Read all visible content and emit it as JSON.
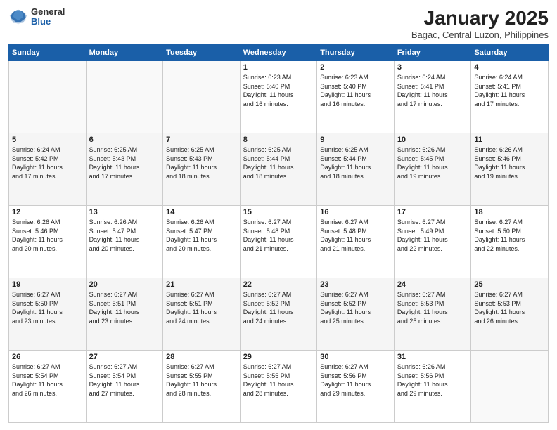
{
  "logo": {
    "general": "General",
    "blue": "Blue"
  },
  "header": {
    "title": "January 2025",
    "subtitle": "Bagac, Central Luzon, Philippines"
  },
  "weekdays": [
    "Sunday",
    "Monday",
    "Tuesday",
    "Wednesday",
    "Thursday",
    "Friday",
    "Saturday"
  ],
  "weeks": [
    [
      {
        "day": "",
        "info": ""
      },
      {
        "day": "",
        "info": ""
      },
      {
        "day": "",
        "info": ""
      },
      {
        "day": "1",
        "info": "Sunrise: 6:23 AM\nSunset: 5:40 PM\nDaylight: 11 hours\nand 16 minutes."
      },
      {
        "day": "2",
        "info": "Sunrise: 6:23 AM\nSunset: 5:40 PM\nDaylight: 11 hours\nand 16 minutes."
      },
      {
        "day": "3",
        "info": "Sunrise: 6:24 AM\nSunset: 5:41 PM\nDaylight: 11 hours\nand 17 minutes."
      },
      {
        "day": "4",
        "info": "Sunrise: 6:24 AM\nSunset: 5:41 PM\nDaylight: 11 hours\nand 17 minutes."
      }
    ],
    [
      {
        "day": "5",
        "info": "Sunrise: 6:24 AM\nSunset: 5:42 PM\nDaylight: 11 hours\nand 17 minutes."
      },
      {
        "day": "6",
        "info": "Sunrise: 6:25 AM\nSunset: 5:43 PM\nDaylight: 11 hours\nand 17 minutes."
      },
      {
        "day": "7",
        "info": "Sunrise: 6:25 AM\nSunset: 5:43 PM\nDaylight: 11 hours\nand 18 minutes."
      },
      {
        "day": "8",
        "info": "Sunrise: 6:25 AM\nSunset: 5:44 PM\nDaylight: 11 hours\nand 18 minutes."
      },
      {
        "day": "9",
        "info": "Sunrise: 6:25 AM\nSunset: 5:44 PM\nDaylight: 11 hours\nand 18 minutes."
      },
      {
        "day": "10",
        "info": "Sunrise: 6:26 AM\nSunset: 5:45 PM\nDaylight: 11 hours\nand 19 minutes."
      },
      {
        "day": "11",
        "info": "Sunrise: 6:26 AM\nSunset: 5:46 PM\nDaylight: 11 hours\nand 19 minutes."
      }
    ],
    [
      {
        "day": "12",
        "info": "Sunrise: 6:26 AM\nSunset: 5:46 PM\nDaylight: 11 hours\nand 20 minutes."
      },
      {
        "day": "13",
        "info": "Sunrise: 6:26 AM\nSunset: 5:47 PM\nDaylight: 11 hours\nand 20 minutes."
      },
      {
        "day": "14",
        "info": "Sunrise: 6:26 AM\nSunset: 5:47 PM\nDaylight: 11 hours\nand 20 minutes."
      },
      {
        "day": "15",
        "info": "Sunrise: 6:27 AM\nSunset: 5:48 PM\nDaylight: 11 hours\nand 21 minutes."
      },
      {
        "day": "16",
        "info": "Sunrise: 6:27 AM\nSunset: 5:48 PM\nDaylight: 11 hours\nand 21 minutes."
      },
      {
        "day": "17",
        "info": "Sunrise: 6:27 AM\nSunset: 5:49 PM\nDaylight: 11 hours\nand 22 minutes."
      },
      {
        "day": "18",
        "info": "Sunrise: 6:27 AM\nSunset: 5:50 PM\nDaylight: 11 hours\nand 22 minutes."
      }
    ],
    [
      {
        "day": "19",
        "info": "Sunrise: 6:27 AM\nSunset: 5:50 PM\nDaylight: 11 hours\nand 23 minutes."
      },
      {
        "day": "20",
        "info": "Sunrise: 6:27 AM\nSunset: 5:51 PM\nDaylight: 11 hours\nand 23 minutes."
      },
      {
        "day": "21",
        "info": "Sunrise: 6:27 AM\nSunset: 5:51 PM\nDaylight: 11 hours\nand 24 minutes."
      },
      {
        "day": "22",
        "info": "Sunrise: 6:27 AM\nSunset: 5:52 PM\nDaylight: 11 hours\nand 24 minutes."
      },
      {
        "day": "23",
        "info": "Sunrise: 6:27 AM\nSunset: 5:52 PM\nDaylight: 11 hours\nand 25 minutes."
      },
      {
        "day": "24",
        "info": "Sunrise: 6:27 AM\nSunset: 5:53 PM\nDaylight: 11 hours\nand 25 minutes."
      },
      {
        "day": "25",
        "info": "Sunrise: 6:27 AM\nSunset: 5:53 PM\nDaylight: 11 hours\nand 26 minutes."
      }
    ],
    [
      {
        "day": "26",
        "info": "Sunrise: 6:27 AM\nSunset: 5:54 PM\nDaylight: 11 hours\nand 26 minutes."
      },
      {
        "day": "27",
        "info": "Sunrise: 6:27 AM\nSunset: 5:54 PM\nDaylight: 11 hours\nand 27 minutes."
      },
      {
        "day": "28",
        "info": "Sunrise: 6:27 AM\nSunset: 5:55 PM\nDaylight: 11 hours\nand 28 minutes."
      },
      {
        "day": "29",
        "info": "Sunrise: 6:27 AM\nSunset: 5:55 PM\nDaylight: 11 hours\nand 28 minutes."
      },
      {
        "day": "30",
        "info": "Sunrise: 6:27 AM\nSunset: 5:56 PM\nDaylight: 11 hours\nand 29 minutes."
      },
      {
        "day": "31",
        "info": "Sunrise: 6:26 AM\nSunset: 5:56 PM\nDaylight: 11 hours\nand 29 minutes."
      },
      {
        "day": "",
        "info": ""
      }
    ]
  ]
}
